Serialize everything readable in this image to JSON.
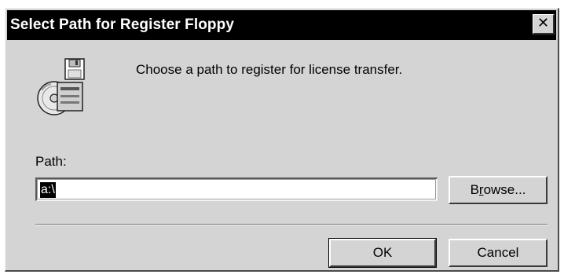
{
  "window": {
    "title": "Select Path for Register Floppy",
    "close_glyph": "✕"
  },
  "icon": {
    "name": "floppy-disk-cd-icon"
  },
  "message": "Choose a path to register for license transfer.",
  "path": {
    "label": "Path:",
    "value": "a:\\"
  },
  "buttons": {
    "browse_prefix": "B",
    "browse_accel": "r",
    "browse_suffix": "owse...",
    "ok": "OK",
    "cancel": "Cancel"
  }
}
